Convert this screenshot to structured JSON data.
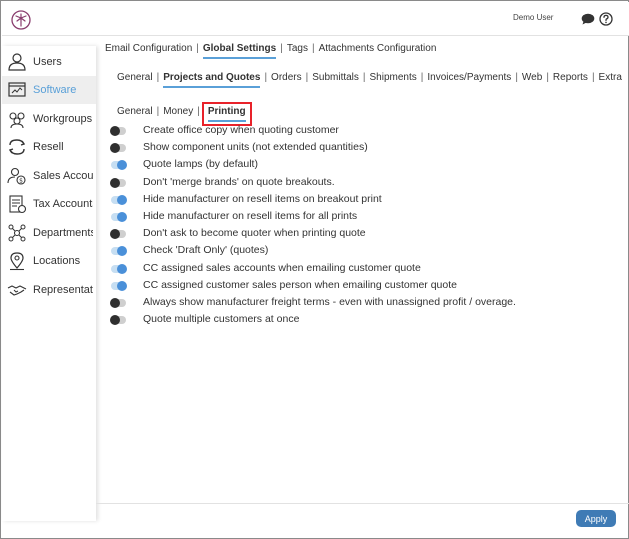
{
  "header": {
    "user_name": "Demo User",
    "brand_color": "#8a3e6e"
  },
  "sidebar": {
    "active_index": 1,
    "items": [
      {
        "label": "Users",
        "icon": "user-icon"
      },
      {
        "label": "Software",
        "icon": "software-icon"
      },
      {
        "label": "Workgroups",
        "icon": "workgroups-icon"
      },
      {
        "label": "Resell",
        "icon": "resell-icon"
      },
      {
        "label": "Sales Accounts",
        "icon": "sales-accounts-icon"
      },
      {
        "label": "Tax Accounts",
        "icon": "tax-accounts-icon"
      },
      {
        "label": "Departments",
        "icon": "departments-icon"
      },
      {
        "label": "Locations",
        "icon": "location-pin-icon"
      },
      {
        "label": "Representatives",
        "icon": "handshake-icon"
      }
    ]
  },
  "tabs_primary": [
    {
      "label": "Email Configuration",
      "active": false
    },
    {
      "label": "Global Settings",
      "active": true
    },
    {
      "label": "Tags",
      "active": false
    },
    {
      "label": "Attachments Configuration",
      "active": false
    }
  ],
  "tabs_secondary": [
    {
      "label": "General",
      "active": false
    },
    {
      "label": "Projects and Quotes",
      "active": true
    },
    {
      "label": "Orders",
      "active": false
    },
    {
      "label": "Submittals",
      "active": false
    },
    {
      "label": "Shipments",
      "active": false
    },
    {
      "label": "Invoices/Payments",
      "active": false
    },
    {
      "label": "Web",
      "active": false
    },
    {
      "label": "Reports",
      "active": false
    },
    {
      "label": "Extra",
      "active": false
    }
  ],
  "tabs_tertiary": [
    {
      "label": "General",
      "active": false
    },
    {
      "label": "Money",
      "active": false
    },
    {
      "label": "Printing",
      "active": true
    }
  ],
  "options": [
    {
      "label": "Create office copy when quoting customer",
      "enabled": false
    },
    {
      "label": "Show component units (not extended quantities)",
      "enabled": false
    },
    {
      "label": "Quote lamps (by default)",
      "enabled": true
    },
    {
      "label": "Don't 'merge brands' on quote breakouts.",
      "enabled": false
    },
    {
      "label": "Hide manufacturer on resell items on breakout print",
      "enabled": true
    },
    {
      "label": "Hide manufacturer on resell items for all prints",
      "enabled": true
    },
    {
      "label": "Don't ask to become quoter when printing quote",
      "enabled": false
    },
    {
      "label": "Check 'Draft Only' (quotes)",
      "enabled": true
    },
    {
      "label": "CC assigned sales accounts when emailing customer quote",
      "enabled": true
    },
    {
      "label": "CC assigned customer sales person when emailing customer quote",
      "enabled": true
    },
    {
      "label": "Always show manufacturer freight terms - even with unassigned profit / overage.",
      "enabled": false
    },
    {
      "label": "Quote multiple customers at once",
      "enabled": false
    }
  ],
  "footer": {
    "apply_label": "Apply"
  }
}
